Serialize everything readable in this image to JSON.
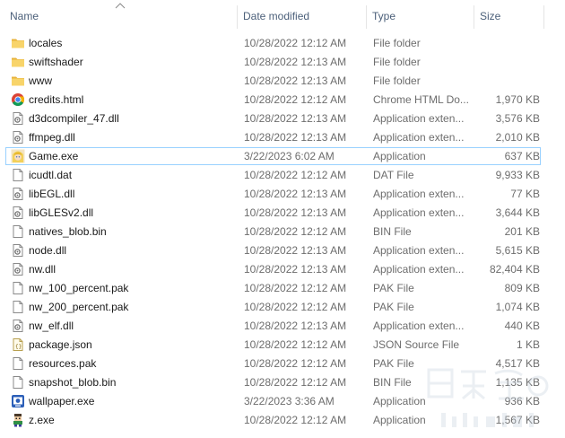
{
  "columns": {
    "name": "Name",
    "date": "Date modified",
    "type": "Type",
    "size": "Size"
  },
  "colors": {
    "header_text": "#4c607a",
    "secondary_text": "#6d6d6d",
    "primary_text": "#1a1a1a",
    "focus_border": "#99d1ff",
    "folder": "#f5c84c"
  },
  "files": [
    {
      "name": "locales",
      "date": "10/28/2022 12:12 AM",
      "type": "File folder",
      "size": "",
      "icon": "folder-icon"
    },
    {
      "name": "swiftshader",
      "date": "10/28/2022 12:13 AM",
      "type": "File folder",
      "size": "",
      "icon": "folder-icon"
    },
    {
      "name": "www",
      "date": "10/28/2022 12:13 AM",
      "type": "File folder",
      "size": "",
      "icon": "folder-icon"
    },
    {
      "name": "credits.html",
      "date": "10/28/2022 12:12 AM",
      "type": "Chrome HTML Do...",
      "size": "1,970 KB",
      "icon": "chrome-icon"
    },
    {
      "name": "d3dcompiler_47.dll",
      "date": "10/28/2022 12:13 AM",
      "type": "Application exten...",
      "size": "3,576 KB",
      "icon": "dll-icon"
    },
    {
      "name": "ffmpeg.dll",
      "date": "10/28/2022 12:13 AM",
      "type": "Application exten...",
      "size": "2,010 KB",
      "icon": "dll-icon"
    },
    {
      "name": "Game.exe",
      "date": "3/22/2023 6:02 AM",
      "type": "Application",
      "size": "637 KB",
      "icon": "game-exe-icon"
    },
    {
      "name": "icudtl.dat",
      "date": "10/28/2022 12:12 AM",
      "type": "DAT File",
      "size": "9,933 KB",
      "icon": "file-icon"
    },
    {
      "name": "libEGL.dll",
      "date": "10/28/2022 12:13 AM",
      "type": "Application exten...",
      "size": "77 KB",
      "icon": "dll-icon"
    },
    {
      "name": "libGLESv2.dll",
      "date": "10/28/2022 12:13 AM",
      "type": "Application exten...",
      "size": "3,644 KB",
      "icon": "dll-icon"
    },
    {
      "name": "natives_blob.bin",
      "date": "10/28/2022 12:12 AM",
      "type": "BIN File",
      "size": "201 KB",
      "icon": "file-icon"
    },
    {
      "name": "node.dll",
      "date": "10/28/2022 12:13 AM",
      "type": "Application exten...",
      "size": "5,615 KB",
      "icon": "dll-icon"
    },
    {
      "name": "nw.dll",
      "date": "10/28/2022 12:13 AM",
      "type": "Application exten...",
      "size": "82,404 KB",
      "icon": "dll-icon"
    },
    {
      "name": "nw_100_percent.pak",
      "date": "10/28/2022 12:12 AM",
      "type": "PAK File",
      "size": "809 KB",
      "icon": "file-icon"
    },
    {
      "name": "nw_200_percent.pak",
      "date": "10/28/2022 12:12 AM",
      "type": "PAK File",
      "size": "1,074 KB",
      "icon": "file-icon"
    },
    {
      "name": "nw_elf.dll",
      "date": "10/28/2022 12:13 AM",
      "type": "Application exten...",
      "size": "440 KB",
      "icon": "dll-icon"
    },
    {
      "name": "package.json",
      "date": "10/28/2022 12:12 AM",
      "type": "JSON Source File",
      "size": "1 KB",
      "icon": "json-icon"
    },
    {
      "name": "resources.pak",
      "date": "10/28/2022 12:12 AM",
      "type": "PAK File",
      "size": "4,517 KB",
      "icon": "file-icon"
    },
    {
      "name": "snapshot_blob.bin",
      "date": "10/28/2022 12:12 AM",
      "type": "BIN File",
      "size": "1,135 KB",
      "icon": "file-icon"
    },
    {
      "name": "wallpaper.exe",
      "date": "3/22/2023 3:36 AM",
      "type": "Application",
      "size": "936 KB",
      "icon": "wallpaper-exe-icon"
    },
    {
      "name": "z.exe",
      "date": "10/28/2022 12:12 AM",
      "type": "Application",
      "size": "1,567 KB",
      "icon": "z-exe-icon"
    }
  ],
  "focused_index": 6,
  "sort": {
    "column": "name",
    "direction": "ascending"
  }
}
